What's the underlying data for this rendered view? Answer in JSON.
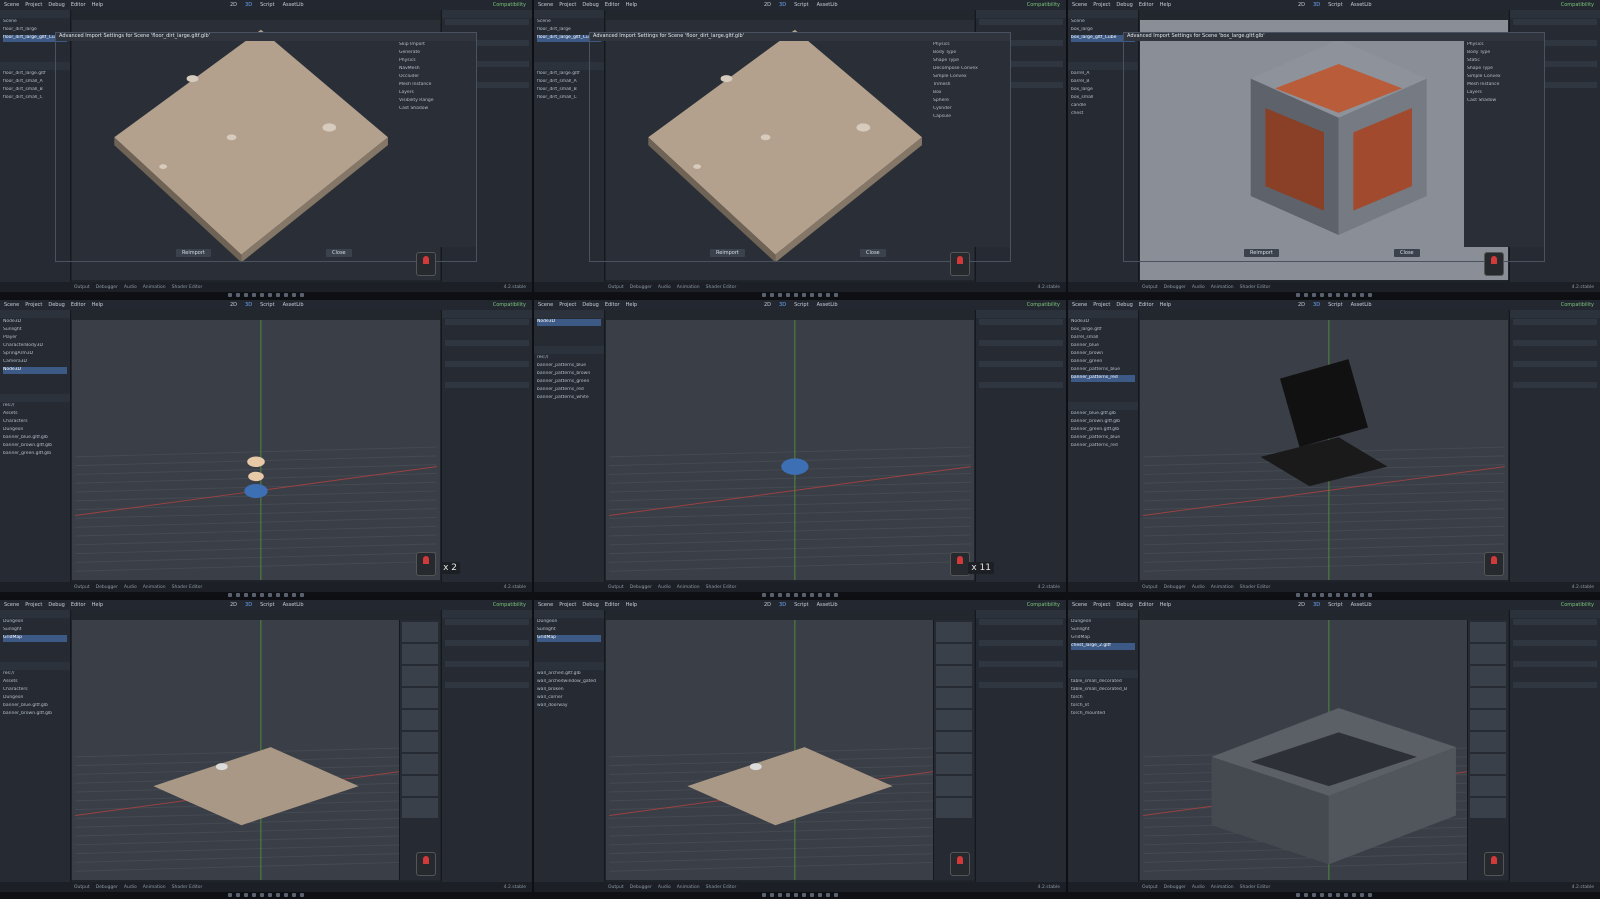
{
  "app": {
    "menus": [
      "Scene",
      "Project",
      "Debug",
      "Editor",
      "Help"
    ],
    "modes": [
      "2D",
      "3D",
      "Script",
      "AssetLib"
    ],
    "active_mode": "3D",
    "renderer": "Compatibility",
    "version": "4.2.stable"
  },
  "bottom_tabs": [
    "Output",
    "Debugger",
    "Audio",
    "Animation",
    "Shader Editor"
  ],
  "tiles": [
    {
      "kind": "import-dialog",
      "dialog_title": "Advanced Import Settings for Scene 'floor_dirt_large.gltf.glb'",
      "scene_items": [
        "Scene",
        "floor_dirt_large",
        "floor_dirt_large_gltf_Cube"
      ],
      "left_files": [
        "floor_dirt_large.gltf",
        "floor_dirt_small_A",
        "floor_dirt_small_B",
        "floor_dirt_small_C"
      ],
      "import_props": [
        "Skip Import",
        "Generate",
        "Physics",
        "NavMesh",
        "Occluder",
        "Mesh Instance",
        "Layers",
        "Visibility Range",
        "Cast Shadow"
      ],
      "reimport_label": "Reimport",
      "close_label": "Close",
      "viewport_color": "#2a2f37",
      "object_color": "#b9a794"
    },
    {
      "kind": "import-dialog",
      "dialog_title": "Advanced Import Settings for Scene 'floor_dirt_large.gltf.glb'",
      "scene_items": [
        "Scene",
        "floor_dirt_large",
        "floor_dirt_large_gltf_Cube"
      ],
      "left_files": [
        "floor_dirt_large.gltf",
        "floor_dirt_small_A",
        "floor_dirt_small_B",
        "floor_dirt_small_C"
      ],
      "import_props": [
        "Physics",
        "Body Type",
        "Shape Type",
        "Decompose Convex",
        "Simple Convex",
        "Trimesh",
        "Box",
        "Sphere",
        "Cylinder",
        "Capsule"
      ],
      "reimport_label": "Reimport",
      "close_label": "Close",
      "viewport_color": "#2a2f37",
      "object_color": "#b9a794"
    },
    {
      "kind": "import-dialog-box",
      "dialog_title": "Advanced Import Settings for Scene 'box_large.gltf.glb'",
      "scene_items": [
        "Scene",
        "box_large",
        "box_large_gltf_Cube"
      ],
      "left_files": [
        "barrel_A",
        "barrel_B",
        "box_large",
        "box_small",
        "candle",
        "chest"
      ],
      "import_props": [
        "Physics",
        "Body Type",
        "Static",
        "Shape Type",
        "Simple Convex",
        "Mesh Instance",
        "Layers",
        "Cast Shadow"
      ],
      "reimport_label": "Reimport",
      "close_label": "Close",
      "viewport_color": "#8a8f97",
      "object_color": "#b9a794"
    },
    {
      "kind": "scene-character",
      "scene_title": "Perspective",
      "tree": [
        "Node3D",
        "Sunlight",
        "Player",
        "CharacterBody3D",
        "SpringArm3D",
        "Camera3D",
        "Node3D"
      ],
      "files": [
        "res://",
        "Assets",
        "Characters",
        "Dungeon",
        "banner_blue.gltf.glb",
        "banner_brown.gltf.glb",
        "banner_green.gltf.glb"
      ],
      "counter": "x 2",
      "viewport_color": "#3a3e46",
      "object_color": "#b9a794"
    },
    {
      "kind": "scene-empty",
      "scene_title": "Perspective",
      "tree": [
        "Node3D"
      ],
      "files": [
        "res://",
        "banner_patterns_blue",
        "banner_patterns_brown",
        "banner_patterns_green",
        "banner_patterns_red",
        "banner_patterns_white"
      ],
      "counter": "x 11",
      "viewport_color": "#3a3e46",
      "object_color": "#b9a794"
    },
    {
      "kind": "scene-banner",
      "scene_title": "Perspective",
      "tree": [
        "Node3D",
        "box_large.gltf",
        "barrel_small",
        "banner_blue",
        "banner_brown",
        "banner_green",
        "banner_patterns_blue",
        "banner_patterns_red"
      ],
      "files": [
        "banner_blue.gltf.glb",
        "banner_brown.gltf.glb",
        "banner_green.gltf.glb",
        "banner_patterns_blue",
        "banner_patterns_red"
      ],
      "counter": "",
      "viewport_color": "#3a3e46",
      "object_color": "#b9a794"
    },
    {
      "kind": "scene-gridmap",
      "scene_title": "Perspective",
      "tree": [
        "Dungeon",
        "Sunlight",
        "GridMap"
      ],
      "files": [
        "res://",
        "Assets",
        "Characters",
        "Dungeon",
        "banner_blue.gltf.glb",
        "banner_brown.gltf.glb"
      ],
      "counter": "",
      "viewport_color": "#3a3e46",
      "object_color": "#b9a794"
    },
    {
      "kind": "scene-gridmap",
      "scene_title": "Perspective",
      "tree": [
        "Dungeon",
        "Sunlight",
        "GridMap"
      ],
      "files": [
        "wall_arched.gltf.glb",
        "wall_archedwindow_gated",
        "wall_broken",
        "wall_corner",
        "wall_doorway"
      ],
      "counter": "",
      "viewport_color": "#3a3e46",
      "object_color": "#b9a794"
    },
    {
      "kind": "scene-room",
      "scene_title": "Perspective",
      "tree": [
        "Dungeon",
        "Sunlight",
        "GridMap",
        "chest_large_2.gltf"
      ],
      "files": [
        "table_small_decorated",
        "table_small_decorated_B",
        "torch",
        "torch_lit",
        "torch_mounted"
      ],
      "counter": "",
      "viewport_color": "#3a3e46",
      "object_color": "#b9a794"
    }
  ]
}
